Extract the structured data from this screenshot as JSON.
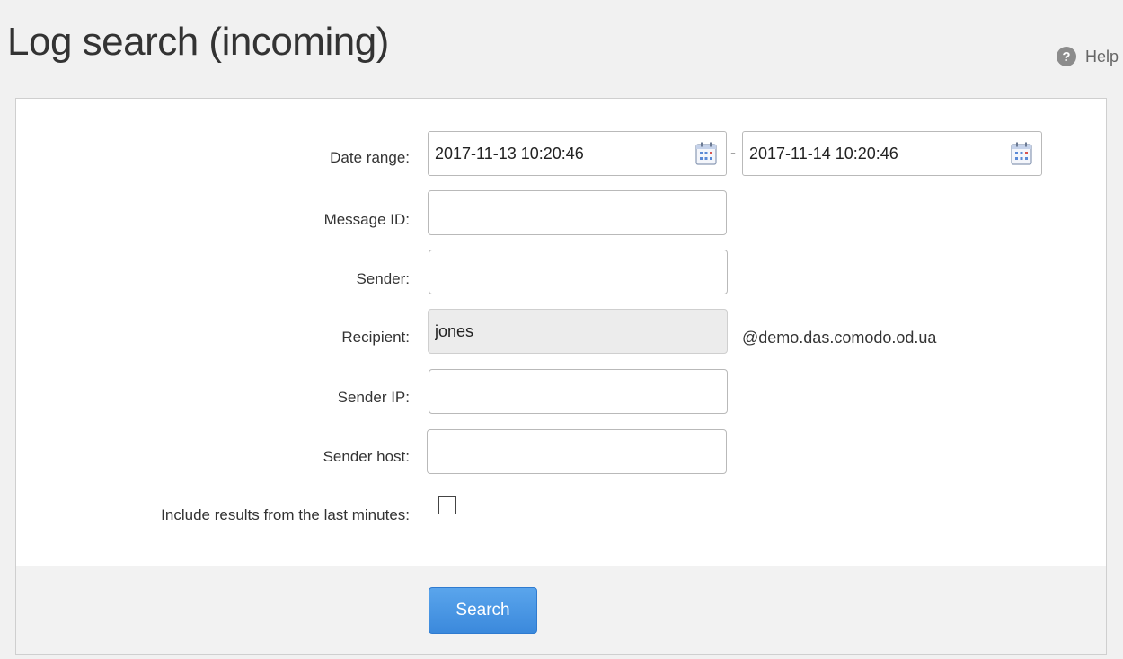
{
  "header": {
    "title": "Log search (incoming)",
    "help_icon": "question-circle-icon",
    "help_label": "Help"
  },
  "form": {
    "date_range": {
      "label": "Date range:",
      "from": "2017-11-13 10:20:46",
      "to": "2017-11-14 10:20:46",
      "separator": "-",
      "icon": "calendar-icon"
    },
    "message_id": {
      "label": "Message ID:",
      "value": ""
    },
    "sender": {
      "label": "Sender:",
      "value": ""
    },
    "recipient": {
      "label": "Recipient:",
      "value": "jones",
      "domain": "@demo.das.comodo.od.ua"
    },
    "sender_ip": {
      "label": "Sender IP:",
      "value": ""
    },
    "sender_host": {
      "label": "Sender host:",
      "value": ""
    },
    "include_recent": {
      "label": "Include results from the last minutes:",
      "checked": false
    }
  },
  "actions": {
    "search_label": "Search"
  },
  "colors": {
    "accent": "#3b89dc",
    "page_background": "#f1f1f1",
    "footer_background": "#f2f2f2"
  }
}
